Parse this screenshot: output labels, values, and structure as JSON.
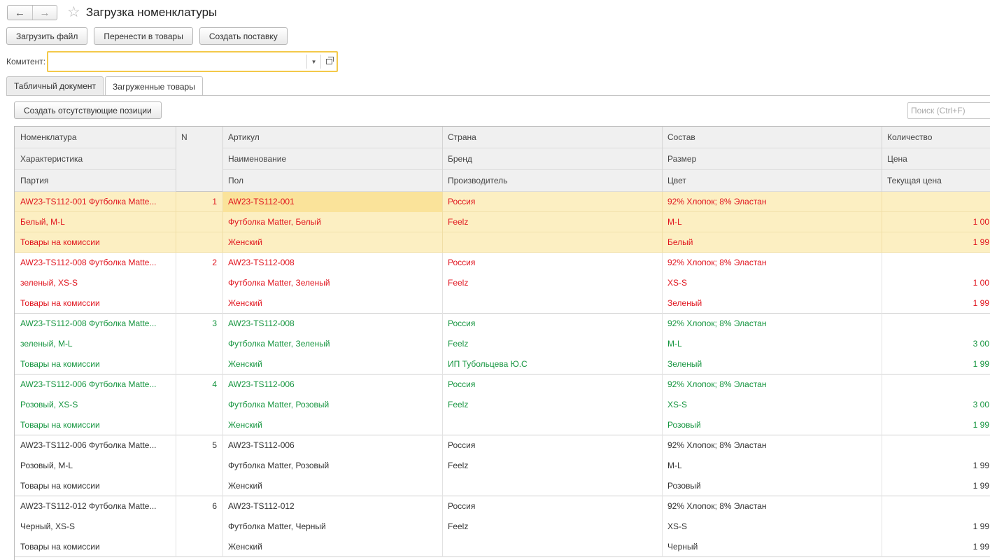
{
  "window": {
    "title": "Загрузка номенклатуры",
    "back_icon": "←",
    "forward_icon": "→",
    "star_icon": "☆"
  },
  "toolbar": {
    "load_file": "Загрузить файл",
    "move_to_goods": "Перенести в товары",
    "create_supply": "Создать поставку"
  },
  "komitent": {
    "label": "Комитент:",
    "value": ""
  },
  "tabs": [
    {
      "label": "Табличный документ"
    },
    {
      "label": "Загруженные товары"
    }
  ],
  "create_missing_button": "Создать отсутствующие позиции",
  "search": {
    "placeholder": "Поиск (Ctrl+F)"
  },
  "colors": {
    "red": "#e0131d",
    "green": "#15953f",
    "dark": "#333333",
    "selected_bg": "#fcefc2",
    "selected_cell": "#fae39a",
    "field_border": "#f3c94a"
  },
  "headers": {
    "c1": [
      "Номенклатура",
      "Характеристика",
      "Партия"
    ],
    "c2": [
      "N"
    ],
    "c3": [
      "Артикул",
      "Наименование",
      "Пол"
    ],
    "c4": [
      "Страна",
      "Бренд",
      "Производитель"
    ],
    "c5": [
      "Состав",
      "Размер",
      "Цвет"
    ],
    "c6": [
      "Количество",
      "Цена",
      "Текущая цена"
    ]
  },
  "rows": [
    {
      "status": "red",
      "selected": true,
      "n": "1",
      "c1": [
        "AW23-TS112-001 Футболка Matte...",
        "Белый, M-L",
        "Товары на комиссии"
      ],
      "c3": [
        "AW23-TS112-001",
        "Футболка Matter, Белый",
        "Женский"
      ],
      "c4": [
        "Россия",
        "Feelz",
        ""
      ],
      "c5": [
        "92% Хлопок; 8% Эластан",
        "M-L",
        "Белый"
      ],
      "c6": [
        "",
        "1 00",
        "1 99"
      ]
    },
    {
      "status": "red",
      "selected": false,
      "n": "2",
      "c1": [
        "AW23-TS112-008 Футболка Matte...",
        "зеленый, XS-S",
        "Товары на комиссии"
      ],
      "c3": [
        "AW23-TS112-008",
        "Футболка Matter, Зеленый",
        "Женский"
      ],
      "c4": [
        "Россия",
        "Feelz",
        ""
      ],
      "c5": [
        "92% Хлопок; 8% Эластан",
        "XS-S",
        "Зеленый"
      ],
      "c6": [
        "",
        "1 00",
        "1 99"
      ]
    },
    {
      "status": "green",
      "selected": false,
      "n": "3",
      "c1": [
        "AW23-TS112-008 Футболка Matte...",
        "зеленый, M-L",
        "Товары на комиссии"
      ],
      "c3": [
        "AW23-TS112-008",
        "Футболка Matter, Зеленый",
        "Женский"
      ],
      "c4": [
        "Россия",
        "Feelz",
        "ИП Тубольцева Ю.С"
      ],
      "c5": [
        "92% Хлопок; 8% Эластан",
        "M-L",
        "Зеленый"
      ],
      "c6": [
        "",
        "3 00",
        "1 99"
      ]
    },
    {
      "status": "green",
      "selected": false,
      "n": "4",
      "c1": [
        "AW23-TS112-006 Футболка Matte...",
        "Розовый, XS-S",
        "Товары на комиссии"
      ],
      "c3": [
        "AW23-TS112-006",
        "Футболка Matter, Розовый",
        "Женский"
      ],
      "c4": [
        "Россия",
        "Feelz",
        ""
      ],
      "c5": [
        "92% Хлопок; 8% Эластан",
        "XS-S",
        "Розовый"
      ],
      "c6": [
        "",
        "3 00",
        "1 99"
      ]
    },
    {
      "status": "dark",
      "selected": false,
      "n": "5",
      "c1": [
        "AW23-TS112-006 Футболка Matte...",
        "Розовый, M-L",
        "Товары на комиссии"
      ],
      "c3": [
        "AW23-TS112-006",
        "Футболка Matter, Розовый",
        "Женский"
      ],
      "c4": [
        "Россия",
        "Feelz",
        ""
      ],
      "c5": [
        "92% Хлопок; 8% Эластан",
        "M-L",
        "Розовый"
      ],
      "c6": [
        "",
        "1 99",
        "1 99"
      ]
    },
    {
      "status": "dark",
      "selected": false,
      "n": "6",
      "c1": [
        "AW23-TS112-012 Футболка Matte...",
        "Черный, XS-S",
        "Товары на комиссии"
      ],
      "c3": [
        "AW23-TS112-012",
        "Футболка Matter, Черный",
        "Женский"
      ],
      "c4": [
        "Россия",
        "Feelz",
        ""
      ],
      "c5": [
        "92% Хлопок; 8% Эластан",
        "XS-S",
        "Черный"
      ],
      "c6": [
        "",
        "1 99",
        "1 99"
      ]
    }
  ]
}
